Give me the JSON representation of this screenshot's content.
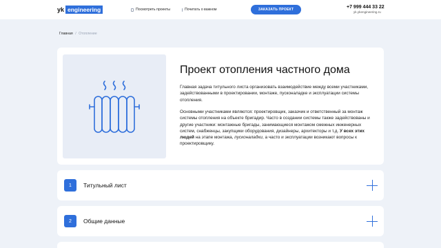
{
  "header": {
    "logo_prefix": "yk",
    "logo_box": "engineering",
    "nav": [
      {
        "label": "Посмотреть проекты",
        "icon": "doc-icon"
      },
      {
        "label": "Почитать о важном",
        "icon": "line-icon"
      }
    ],
    "cta_label": "ЗАКАЗАТЬ ПРОЕКТ",
    "phone": "+7 999 444 33 22",
    "site": "yk.ykengineering.ru"
  },
  "breadcrumb": {
    "home": "Главная",
    "separator": "/",
    "current": "Отопление"
  },
  "article": {
    "title": "Проект отопления частного дома",
    "p1": "Главная задача титульного листа организовать взаимодействие между всеми участниками, задействованными в проектировании, монтаже, пусконаладке и эксплуатации системы отопления.",
    "p2_start": "Основными участниками являются: проектировщик, заказчик и ответственный за монтаж системы отопления на объекте бригадир. Часто в создании системы также задействованы и другие участники: монтажные бригады, занимающиеся монтажом смежных инженерных систем, снабженцы, закупщики оборудования, дизайнеры, архитекторы и т.д. ",
    "p2_bold": "У всех этих людей",
    "p2_mid": " на этапе монтажа, ",
    "p2_italic": "пусконаладки",
    "p2_end": ", а часто и эксплуатации возникают вопросы к проектировщику.",
    "image_icon": "radiator-icon"
  },
  "accordion": [
    {
      "number": "1",
      "label": "Титульный лист"
    },
    {
      "number": "2",
      "label": "Общие данные"
    }
  ],
  "colors": {
    "accent": "#2f6fdb",
    "background": "#eef2f8",
    "illustration_bg": "#e8edf6"
  }
}
